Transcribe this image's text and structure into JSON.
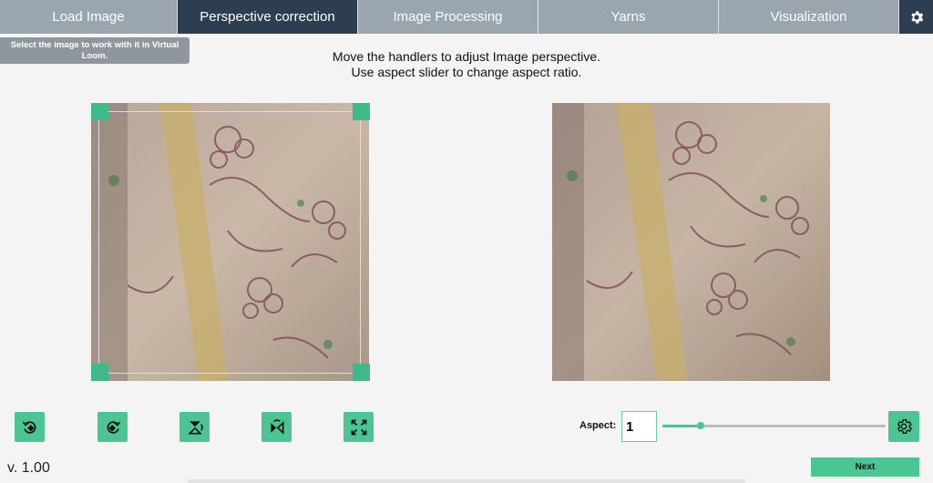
{
  "tabs": [
    {
      "label": "Load Image",
      "active": false
    },
    {
      "label": "Perspective correction",
      "active": true
    },
    {
      "label": "Image Processing",
      "active": false
    },
    {
      "label": "Yarns",
      "active": false
    },
    {
      "label": "Visualization",
      "active": false
    }
  ],
  "tooltip": "Select the image to work with it in Virtual Loom.",
  "instructions": {
    "line1": "Move the handlers to adjust Image perspective.",
    "line2": "Use aspect slider to change aspect ratio."
  },
  "tools": [
    "rotate-left-icon",
    "rotate-right-icon",
    "flip-vertical-icon",
    "flip-horizontal-icon",
    "fit-to-frame-icon"
  ],
  "aspect": {
    "label": "Aspect:",
    "value": "1",
    "slider_fraction": 0.17
  },
  "version": "v. 1.00",
  "next_label": "Next",
  "colors": {
    "accent": "#4cc595",
    "header_active": "#2c3e4f",
    "header_inactive": "#9aa5ae"
  }
}
